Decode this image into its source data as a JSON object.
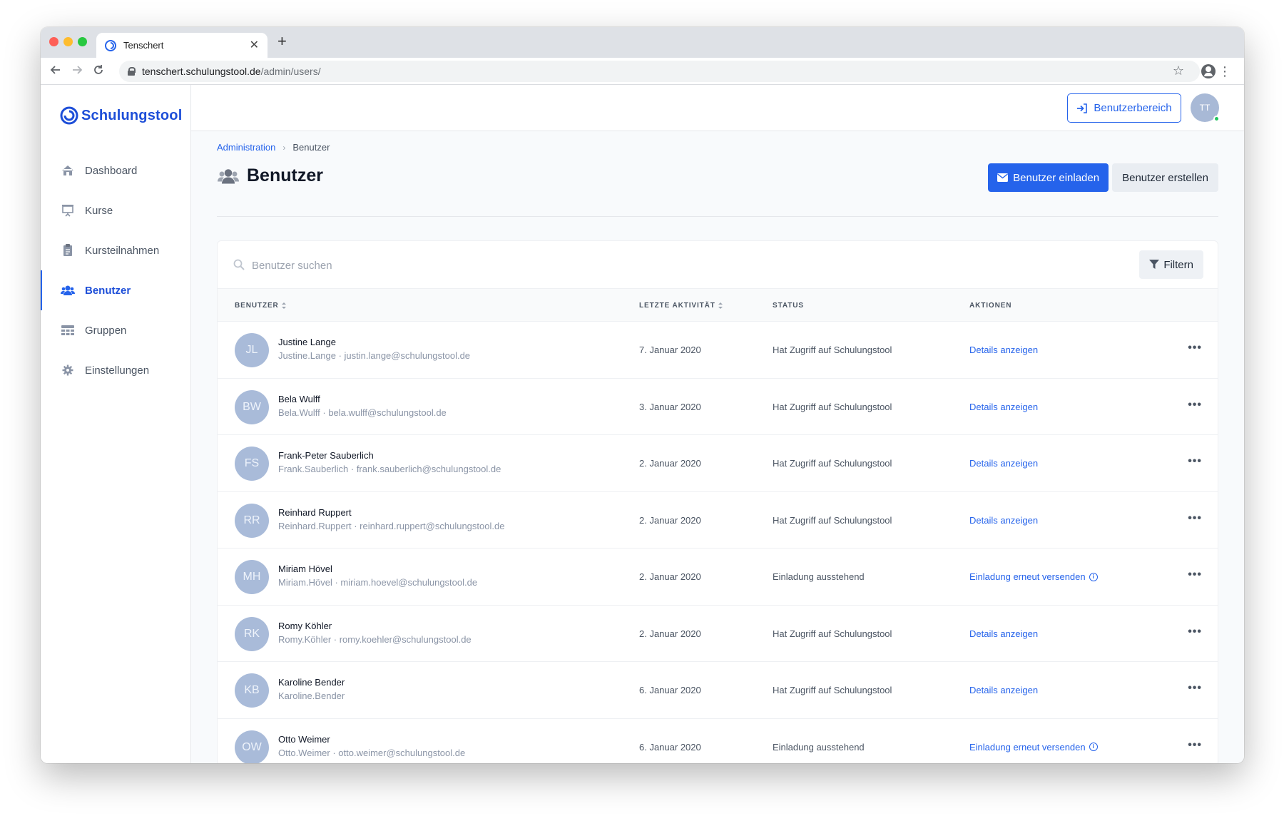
{
  "browser": {
    "tab_title": "Tenschert",
    "tab_close": "✕",
    "new_tab": "+",
    "url_host": "tenschert.schulungstool.de",
    "url_path": "/admin/users/"
  },
  "app": {
    "logo_text": "Schulungstool",
    "brand_color": "#2563eb"
  },
  "sidebar": {
    "items": [
      {
        "label": "Dashboard",
        "icon": "home-icon",
        "active": false
      },
      {
        "label": "Kurse",
        "icon": "presentation-icon",
        "active": false
      },
      {
        "label": "Kursteilnahmen",
        "icon": "clipboard-icon",
        "active": false
      },
      {
        "label": "Benutzer",
        "icon": "users-icon",
        "active": true
      },
      {
        "label": "Gruppen",
        "icon": "groups-icon",
        "active": false
      },
      {
        "label": "Einstellungen",
        "icon": "gear-icon",
        "active": false
      }
    ]
  },
  "topbar": {
    "user_area_label": "Benutzerbereich",
    "avatar_initials": "TT"
  },
  "breadcrumb": {
    "parent": "Administration",
    "separator": "›",
    "current": "Benutzer"
  },
  "page": {
    "title": "Benutzer",
    "invite_label": "Benutzer einladen",
    "create_label": "Benutzer erstellen"
  },
  "search": {
    "placeholder": "Benutzer suchen",
    "value": "",
    "filter_label": "Filtern"
  },
  "table": {
    "columns": {
      "user": "BENUTZER",
      "activity": "LETZTE AKTIVITÄT",
      "status": "STATUS",
      "actions": "AKTIONEN"
    },
    "more_glyph": "•••",
    "rows": [
      {
        "initials": "JL",
        "name": "Justine Lange",
        "sub": "Justine.Lange · justin.lange@schulungstool.de",
        "date": "7. Januar 2020",
        "status": "Hat Zugriff auf Schulungstool",
        "action": "Details anzeigen",
        "info": false
      },
      {
        "initials": "BW",
        "name": "Bela Wulff",
        "sub": "Bela.Wulff · bela.wulff@schulungstool.de",
        "date": "3. Januar 2020",
        "status": "Hat Zugriff auf Schulungstool",
        "action": "Details anzeigen",
        "info": false
      },
      {
        "initials": "FS",
        "name": "Frank-Peter Sauberlich",
        "sub": "Frank.Sauberlich · frank.sauberlich@schulungstool.de",
        "date": "2. Januar 2020",
        "status": "Hat Zugriff auf Schulungstool",
        "action": "Details anzeigen",
        "info": false
      },
      {
        "initials": "RR",
        "name": "Reinhard Ruppert",
        "sub": "Reinhard.Ruppert · reinhard.ruppert@schulungstool.de",
        "date": "2. Januar 2020",
        "status": "Hat Zugriff auf Schulungstool",
        "action": "Details anzeigen",
        "info": false
      },
      {
        "initials": "MH",
        "name": "Miriam Hövel",
        "sub": "Miriam.Hövel · miriam.hoevel@schulungstool.de",
        "date": "2. Januar 2020",
        "status": "Einladung ausstehend",
        "action": "Einladung erneut versenden",
        "info": true
      },
      {
        "initials": "RK",
        "name": "Romy Köhler",
        "sub": "Romy.Köhler · romy.koehler@schulungstool.de",
        "date": "2. Januar 2020",
        "status": "Hat Zugriff auf Schulungstool",
        "action": "Details anzeigen",
        "info": false
      },
      {
        "initials": "KB",
        "name": "Karoline Bender",
        "sub": "Karoline.Bender",
        "date": "6. Januar 2020",
        "status": "Hat Zugriff auf Schulungstool",
        "action": "Details anzeigen",
        "info": false
      },
      {
        "initials": "OW",
        "name": "Otto Weimer",
        "sub": "Otto.Weimer · otto.weimer@schulungstool.de",
        "date": "6. Januar 2020",
        "status": "Einladung ausstehend",
        "action": "Einladung erneut versenden",
        "info": true
      }
    ]
  }
}
